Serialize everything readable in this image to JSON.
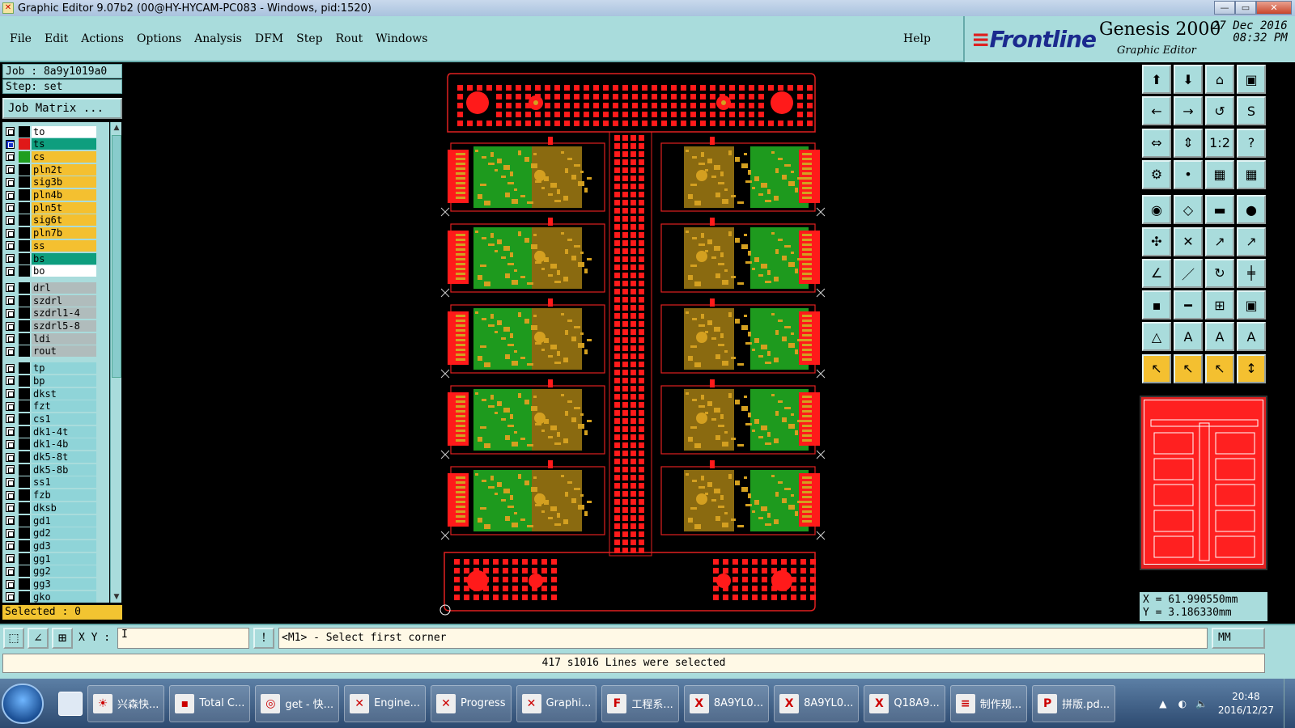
{
  "window": {
    "title": "Graphic Editor 9.07b2 (00@HY-HYCAM-PC083 - Windows, pid:1520)",
    "min": "—",
    "max": "▭",
    "close": "✕"
  },
  "menu": {
    "items": [
      "File",
      "Edit",
      "Actions",
      "Options",
      "Analysis",
      "DFM",
      "Step",
      "Rout",
      "Windows"
    ],
    "help": "Help"
  },
  "brand": {
    "logo": "Frontline",
    "product": "Genesis 2000",
    "subtitle": "Graphic Editor",
    "date": "27 Dec 2016",
    "time": "08:32 PM"
  },
  "job": {
    "job_line": "Job : 8a9y1019a0",
    "step_line": "Step: set",
    "matrix_button": "Job Matrix ..."
  },
  "layers": {
    "board": [
      {
        "name": "to",
        "color": "#ffffff",
        "swatch": "#000000",
        "checked": false
      },
      {
        "name": "ts",
        "color": "#0e9e7e",
        "swatch": "#e01818",
        "checked": true
      },
      {
        "name": "cs",
        "color": "#f4c030",
        "swatch": "#1f9e1f",
        "checked": false
      },
      {
        "name": "pln2t",
        "color": "#f4c030",
        "swatch": "#000000",
        "checked": false
      },
      {
        "name": "sig3b",
        "color": "#f4c030",
        "swatch": "#000000",
        "checked": false
      },
      {
        "name": "pln4b",
        "color": "#f4c030",
        "swatch": "#000000",
        "checked": false
      },
      {
        "name": "pln5t",
        "color": "#f4c030",
        "swatch": "#000000",
        "checked": false
      },
      {
        "name": "sig6t",
        "color": "#f4c030",
        "swatch": "#000000",
        "checked": false
      },
      {
        "name": "pln7b",
        "color": "#f4c030",
        "swatch": "#000000",
        "checked": false
      },
      {
        "name": "ss",
        "color": "#f4c030",
        "swatch": "#000000",
        "checked": false
      },
      {
        "name": "bs",
        "color": "#0e9e7e",
        "swatch": "#000000",
        "checked": false
      },
      {
        "name": "bo",
        "color": "#ffffff",
        "swatch": "#000000",
        "checked": false
      }
    ],
    "drill": [
      "drl",
      "szdrl",
      "szdrl1-4",
      "szdrl5-8",
      "ldi",
      "rout"
    ],
    "misc": [
      "tp",
      "bp",
      "dkst",
      "fzt",
      "cs1",
      "dk1-4t",
      "dk1-4b",
      "dk5-8t",
      "dk5-8b",
      "ss1",
      "fzb",
      "dksb",
      "gd1",
      "gd2",
      "gd3",
      "gg1",
      "gg2",
      "gg3",
      "gko"
    ],
    "drill_color": "#b0bcbc",
    "misc_color": "#8fd4d8",
    "selected": "Selected : 0"
  },
  "canvas": {
    "panel_outline": "#e02020",
    "copper": "#ff1a1a",
    "pad": "#d4a020",
    "mask": "#1e9a1e"
  },
  "toolbox": {
    "rows": [
      [
        "⬆",
        "⬇",
        "⌂",
        "▣"
      ],
      [
        "←",
        "→",
        "↺",
        "S"
      ],
      [
        "⇔",
        "⇕",
        "1:2",
        "?"
      ],
      [
        "⚙",
        "•",
        "▦",
        "▦"
      ],
      [
        "◉",
        "◇",
        "▬",
        "●"
      ],
      [
        "✣",
        "✕",
        "↗",
        "↗"
      ],
      [
        "∠",
        "／",
        "↻",
        "╪"
      ],
      [
        "▪",
        "━",
        "⊞",
        "▣"
      ],
      [
        "△",
        "A",
        "A",
        "A"
      ],
      [
        "↖",
        "↖",
        "↖",
        "↕"
      ]
    ]
  },
  "coords": {
    "x": "X = 61.990550mm",
    "y": "Y = 3.186330mm"
  },
  "command": {
    "xy_label": "X Y :",
    "xy_value": "I",
    "info_btn": "!",
    "prompt": "<M1> - Select first corner",
    "units": "MM"
  },
  "status": {
    "message": "417 s1016 Lines were selected"
  },
  "taskbar": {
    "tasks": [
      {
        "label": "兴森快...",
        "icon": "☀"
      },
      {
        "label": "Total C...",
        "icon": "▪"
      },
      {
        "label": "get - 快...",
        "icon": "◎"
      },
      {
        "label": "Engine...",
        "icon": "✕"
      },
      {
        "label": "Progress",
        "icon": "✕"
      },
      {
        "label": "Graphi...",
        "icon": "✕"
      },
      {
        "label": "工程系...",
        "icon": "F"
      },
      {
        "label": "8A9YL0...",
        "icon": "X"
      },
      {
        "label": "8A9YL0...",
        "icon": "X"
      },
      {
        "label": "Q18A9...",
        "icon": "X"
      },
      {
        "label": "制作规...",
        "icon": "≡"
      },
      {
        "label": "拼版.pd...",
        "icon": "P"
      }
    ],
    "time": "20:48",
    "date": "2016/12/27"
  }
}
